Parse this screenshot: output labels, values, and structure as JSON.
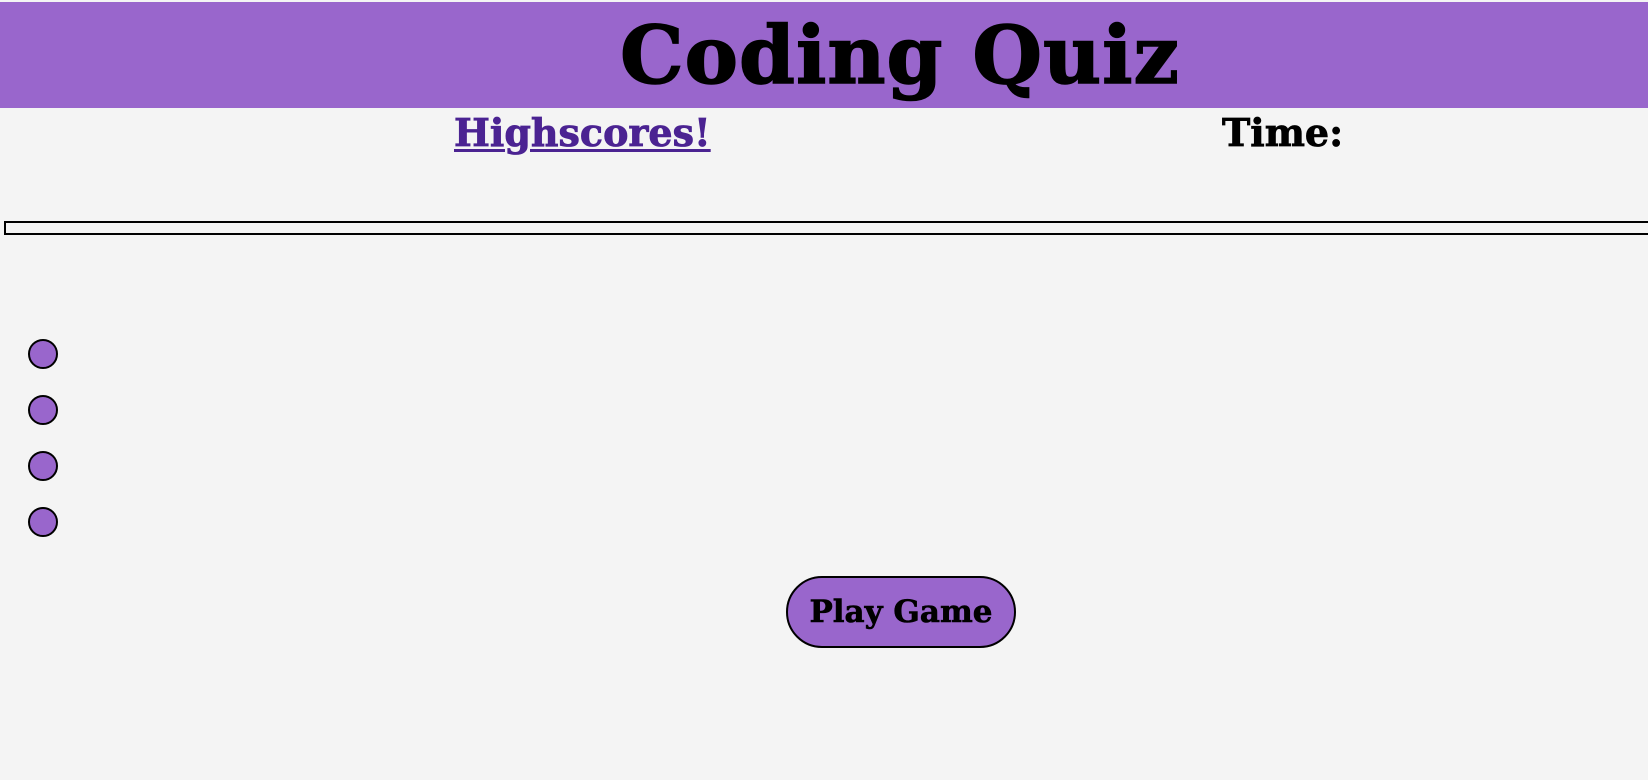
{
  "header": {
    "title": "Coding Quiz"
  },
  "nav": {
    "highscores_label": "Highscores!",
    "time_label": "Time:",
    "time_value": ""
  },
  "question": {
    "text": ""
  },
  "answers": [
    {
      "text": ""
    },
    {
      "text": ""
    },
    {
      "text": ""
    },
    {
      "text": ""
    }
  ],
  "controls": {
    "play_label": "Play Game"
  },
  "colors": {
    "accent": "#9966cc",
    "link": "#4b2392",
    "background": "#f4f4f4",
    "text": "#000000"
  }
}
